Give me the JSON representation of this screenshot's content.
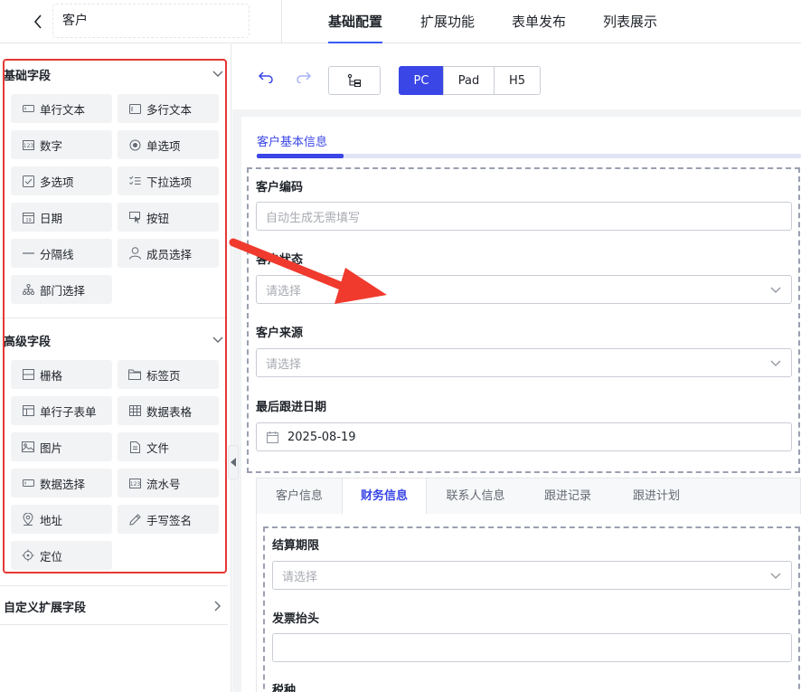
{
  "header": {
    "title_value": "客户",
    "tabs": [
      "基础配置",
      "扩展功能",
      "表单发布",
      "列表展示"
    ]
  },
  "palette": {
    "basic_group": "基础字段",
    "basic_fields": [
      {
        "label": "单行文本",
        "icon": "single-line-text-icon"
      },
      {
        "label": "多行文本",
        "icon": "multi-line-text-icon"
      },
      {
        "label": "数字",
        "icon": "number-icon"
      },
      {
        "label": "单选项",
        "icon": "radio-icon"
      },
      {
        "label": "多选项",
        "icon": "checkbox-icon"
      },
      {
        "label": "下拉选项",
        "icon": "dropdown-list-icon"
      },
      {
        "label": "日期",
        "icon": "calendar-icon"
      },
      {
        "label": "按钮",
        "icon": "cursor-click-icon"
      },
      {
        "label": "分隔线",
        "icon": "divider-line-icon"
      },
      {
        "label": "成员选择",
        "icon": "user-icon"
      },
      {
        "label": "部门选择",
        "icon": "org-tree-icon"
      }
    ],
    "advanced_group": "高级字段",
    "advanced_fields": [
      {
        "label": "栅格",
        "icon": "grid-icon"
      },
      {
        "label": "标签页",
        "icon": "folder-tab-icon"
      },
      {
        "label": "单行子表单",
        "icon": "subform-icon"
      },
      {
        "label": "数据表格",
        "icon": "table-icon"
      },
      {
        "label": "图片",
        "icon": "image-icon"
      },
      {
        "label": "文件",
        "icon": "file-icon"
      },
      {
        "label": "数据选择",
        "icon": "data-select-icon"
      },
      {
        "label": "流水号",
        "icon": "serial-number-icon"
      },
      {
        "label": "地址",
        "icon": "location-pin-icon"
      },
      {
        "label": "手写签名",
        "icon": "pen-icon"
      },
      {
        "label": "定位",
        "icon": "locate-icon"
      }
    ],
    "custom_group": "自定义扩展字段"
  },
  "toolbar": {
    "devices": [
      "PC",
      "Pad",
      "H5"
    ],
    "active_device": "PC"
  },
  "form": {
    "section_tab": "客户基本信息",
    "fields": [
      {
        "label": "客户编码",
        "placeholder": "自动生成无需填写"
      },
      {
        "label": "客户状态",
        "placeholder": "请选择"
      },
      {
        "label": "客户来源",
        "placeholder": "请选择"
      },
      {
        "label": "最后跟进日期",
        "value": "2025-08-19"
      }
    ],
    "sub_tabs": [
      "客户信息",
      "财务信息",
      "联系人信息",
      "跟进记录",
      "跟进计划"
    ],
    "active_sub_tab": "财务信息",
    "sub_fields": [
      {
        "label": "结算期限",
        "placeholder": "请选择"
      },
      {
        "label": "发票抬头",
        "placeholder": ""
      },
      {
        "label": "税种"
      }
    ]
  },
  "colors": {
    "accent": "#3a46e6",
    "highlight_box": "#e53935",
    "arrow": "#f03a2e"
  }
}
